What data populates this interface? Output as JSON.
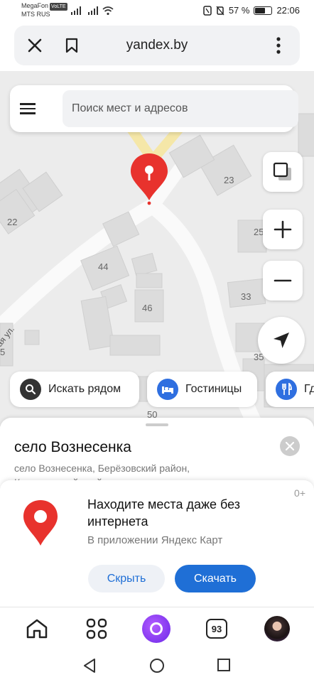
{
  "status_bar": {
    "carrier1": "MegaFon",
    "volte": "VoLTE",
    "carrier2": "MTS RUS",
    "battery_percent": "57 %",
    "time": "22:06"
  },
  "browser": {
    "url": "yandex.by",
    "close_icon": "close-icon",
    "bookmark_icon": "bookmark-icon",
    "more_icon": "more-vertical-icon"
  },
  "map": {
    "search_placeholder": "Поиск мест и адресов",
    "building_numbers": [
      "23",
      "22",
      "25",
      "44",
      "33",
      "46",
      "35",
      "5",
      "50"
    ],
    "street_label": "ая ул.",
    "chips": [
      {
        "label": "Искать рядом",
        "icon": "search-icon",
        "color": "#333333"
      },
      {
        "label": "Гостиницы",
        "icon": "bed-icon",
        "color": "#2f6fe0"
      },
      {
        "label": "Гд",
        "icon": "fork-knife-icon",
        "color": "#2f6fe0"
      }
    ]
  },
  "place_card": {
    "title": "село Вознесенка",
    "subtitle": "село Вознесенка, Берёзовский район, Красноярский край"
  },
  "promo": {
    "age_rating": "0+",
    "title": "Находите места даже без интернета",
    "subtitle": "В приложении Яндекс Карт",
    "hide_label": "Скрыть",
    "download_label": "Скачать"
  },
  "bottom_nav": {
    "tabs_count": "93"
  },
  "colors": {
    "accent": "#1f6fd6",
    "pin": "#e8322d",
    "map_bg": "#ececec",
    "building": "#dcdcdc"
  }
}
